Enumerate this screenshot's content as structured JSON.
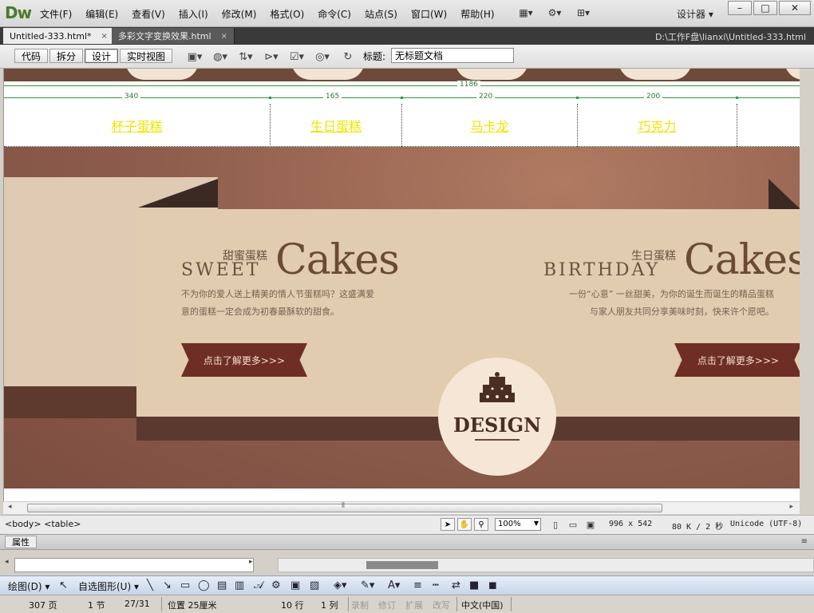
{
  "app": {
    "logo": "Dw",
    "menu": [
      "文件(F)",
      "编辑(E)",
      "查看(V)",
      "插入(I)",
      "修改(M)",
      "格式(O)",
      "命令(C)",
      "站点(S)",
      "窗口(W)",
      "帮助(H)"
    ],
    "workspace": "设计器",
    "workspace_arrow": "▾",
    "win_buttons": {
      "minimize": "–",
      "maximize": "□",
      "close": "✕"
    }
  },
  "tabs": [
    {
      "label": "Untitled-333.html*",
      "close": "×",
      "active": true
    },
    {
      "label": "多彩文字变换效果.html",
      "close": "×",
      "active": false
    }
  ],
  "file_path": "D:\\工作F盘\\lianxi\\Untitled-333.html",
  "doc_toolbar": {
    "views": [
      "代码",
      "拆分",
      "设计",
      "实时视图"
    ],
    "active_view": "设计",
    "title_label": "标题:",
    "title_value": "无标题文档"
  },
  "canvas": {
    "ruler": {
      "total": "1186",
      "cols": [
        "340",
        "165",
        "220",
        "200"
      ]
    },
    "nav": [
      "杯子蛋糕",
      "生日蛋糕",
      "马卡龙",
      "巧克力"
    ],
    "nav_color": "#f0e400",
    "cakes": [
      {
        "cn": "甜蜜蛋糕",
        "en_small": "SWEET",
        "en_big": "Cakes",
        "desc": [
          "不为你的爱人送上精美的情人节蛋糕吗？这盛满爱",
          "意的蛋糕一定会成为初春最酥软的甜食。"
        ],
        "button": "点击了解更多>>>"
      },
      {
        "cn": "生日蛋糕",
        "en_small": "BIRTHDAY",
        "en_big": "Cakes",
        "desc": [
          "一份“心意” 一丝甜美，为你的诞生而诞生的精品蛋糕",
          "与家人朋友共同分享美味时刻，快来许个愿吧。"
        ],
        "button": "点击了解更多>>>"
      }
    ],
    "badge": "DESIGN",
    "colors": {
      "stage": "#8a5a4a",
      "panel": "#e1ccb0",
      "ribbon": "#6e2e26",
      "dark": "#5a3a2e"
    }
  },
  "status": {
    "tag_selector": "<body> <table>",
    "zoom": "100%",
    "window_size": "996 x 542",
    "download": "80 K / 2 秒",
    "encoding": "Unicode (UTF-8)"
  },
  "properties": {
    "label": "属性",
    "options": "≡"
  },
  "drawing_toolbar": {
    "draw": "绘图(D)",
    "autoshapes": "自选图形(U)"
  },
  "word_status": {
    "page": "307 页",
    "section": "1 节",
    "pages": "27/31",
    "position": "位置 25厘米",
    "line": "10 行",
    "col": "1 列",
    "rec": "录制",
    "trk": "修订",
    "ext": "扩展",
    "ovr": "改写",
    "lang": "中文(中国)"
  }
}
